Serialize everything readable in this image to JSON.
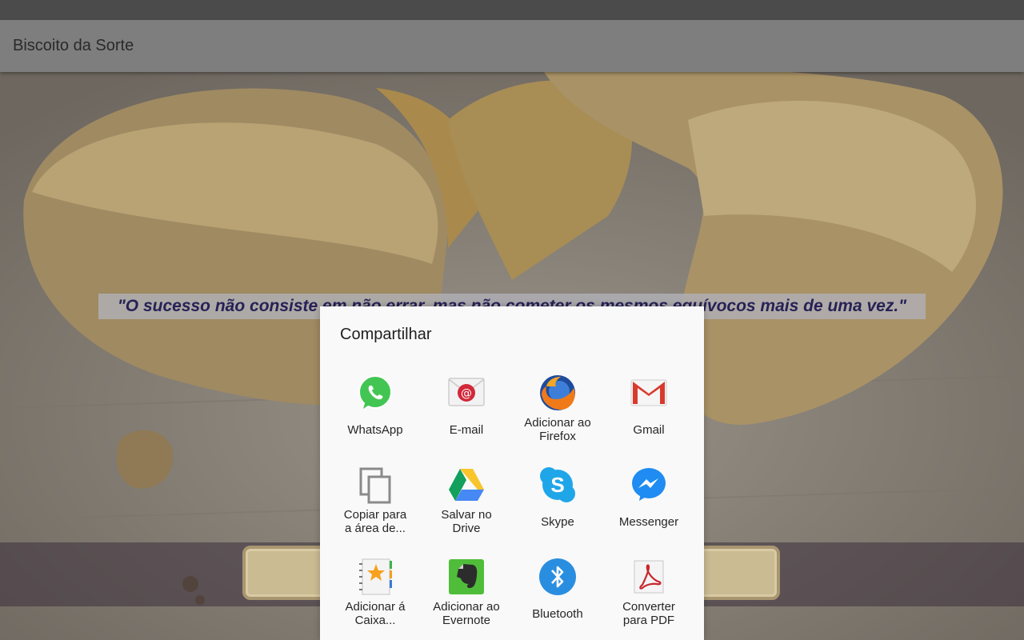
{
  "app": {
    "title": "Biscoito da Sorte"
  },
  "quote": {
    "text": "\"O sucesso não consiste em não errar, mas não cometer os mesmos equívocos mais de uma vez.\""
  },
  "share_sheet": {
    "title": "Compartilhar",
    "rows": [
      [
        {
          "label": "WhatsApp",
          "icon": "whatsapp-icon"
        },
        {
          "label": "E-mail",
          "icon": "email-icon"
        },
        {
          "label": "Adicionar ao Firefox",
          "icon": "firefox-icon"
        },
        {
          "label": "Gmail",
          "icon": "gmail-icon"
        }
      ],
      [
        {
          "label": "Copiar para a área de...",
          "icon": "copy-icon"
        },
        {
          "label": "Salvar no Drive",
          "icon": "google-drive-icon"
        },
        {
          "label": "Skype",
          "icon": "skype-icon"
        },
        {
          "label": "Messenger",
          "icon": "messenger-icon"
        }
      ],
      [
        {
          "label": "Adicionar á Caixa...",
          "icon": "contact-book-icon"
        },
        {
          "label": "Adicionar ao Evernote",
          "icon": "evernote-icon"
        },
        {
          "label": "Bluetooth",
          "icon": "bluetooth-icon"
        },
        {
          "label": "Converter para PDF",
          "icon": "pdf-converter-icon"
        }
      ]
    ]
  },
  "colors": {
    "status_bar": "#4b4b4b",
    "app_bar": "#7e7e7e",
    "quote_text": "#262256",
    "sheet_background": "#f9f9f9",
    "whatsapp": "#43c553",
    "skype": "#1fa6e8",
    "messenger": "#1e8cf2",
    "bluetooth": "#2a8ee0",
    "evernote": "#4fbd3a",
    "gmail_red": "#d93a2e"
  }
}
